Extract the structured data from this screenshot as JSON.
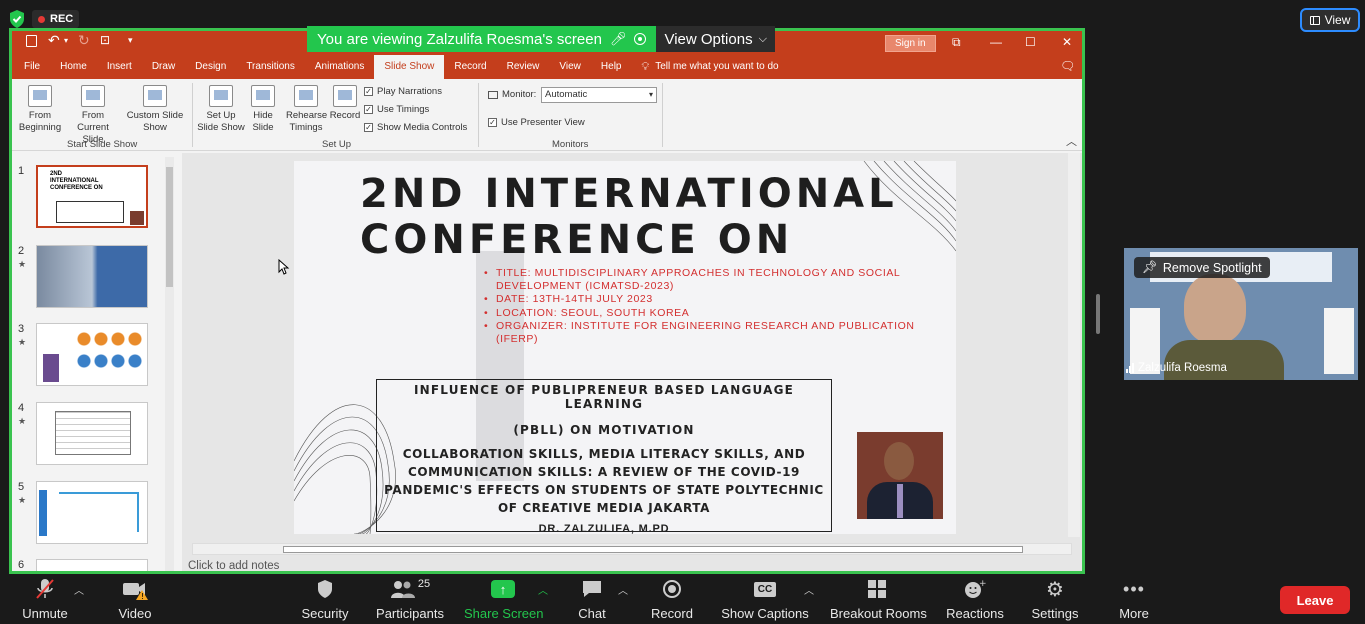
{
  "zoom": {
    "rec_label": "REC",
    "view_button": "View",
    "banner_text": "You are viewing Zalzulifa Roesma's screen",
    "view_options": "View Options"
  },
  "ppt": {
    "sign_in": "Sign in",
    "tabs": [
      "File",
      "Home",
      "Insert",
      "Draw",
      "Design",
      "Transitions",
      "Animations",
      "Slide Show",
      "Record",
      "Review",
      "View",
      "Help"
    ],
    "tell_me": "Tell me what you want to do",
    "ribbon": {
      "from_beginning": "From Beginning",
      "from_current": "From Current Slide",
      "custom_show": "Custom Slide Show",
      "group_start": "Start Slide Show",
      "set_up": "Set Up Slide Show",
      "hide_slide": "Hide Slide",
      "rehearse": "Rehearse Timings",
      "record": "Record",
      "play_narrations": "Play Narrations",
      "use_timings": "Use Timings",
      "show_media": "Show Media Controls",
      "group_setup": "Set Up",
      "monitor_label": "Monitor:",
      "monitor_value": "Automatic",
      "presenter_view": "Use Presenter View",
      "group_monitors": "Monitors"
    },
    "slide_numbers": [
      "1",
      "2",
      "3",
      "4",
      "5",
      "6"
    ],
    "notes_placeholder": "Click to add notes"
  },
  "slide": {
    "title_line1": "2ND INTERNATIONAL",
    "title_line2": "CONFERENCE ON",
    "bullets": [
      "TITLE:  MULTIDISCIPLINARY APPROACHES IN TECHNOLOGY AND SOCIAL DEVELOPMENT (ICMATSD-2023)",
      "DATE: 13TH-14TH JULY 2023",
      "LOCATION: SEOUL, SOUTH KOREA",
      "ORGANIZER: INSTITUTE FOR ENGINEERING RESEARCH AND PUBLICATION (IFERP)"
    ],
    "box_line1": "INFLUENCE OF PUBLIPRENEUR BASED LANGUAGE LEARNING",
    "box_line2": "(PBLL) ON MOTIVATION",
    "box_line3": "COLLABORATION SKILLS, MEDIA LITERACY SKILLS, AND COMMUNICATION SKILLS: A REVIEW OF THE COVID-19 PANDEMIC'S EFFECTS ON STUDENTS OF STATE POLYTECHNIC OF CREATIVE MEDIA JAKARTA",
    "author": "DR. ZALZULIFA, M.PD",
    "thumb1_title": "2ND INTERNATIONAL CONFERENCE ON"
  },
  "video": {
    "spotlight": "Remove Spotlight",
    "name": "Zalzulifa Roesma"
  },
  "toolbar": {
    "unmute": "Unmute",
    "video": "Video",
    "security": "Security",
    "participants": "Participants",
    "participants_count": "25",
    "share_screen": "Share Screen",
    "chat": "Chat",
    "record": "Record",
    "captions": "Show Captions",
    "breakout": "Breakout Rooms",
    "reactions": "Reactions",
    "settings": "Settings",
    "more": "More",
    "leave": "Leave",
    "accent": "#23c64d",
    "leave_color": "#e02828"
  }
}
